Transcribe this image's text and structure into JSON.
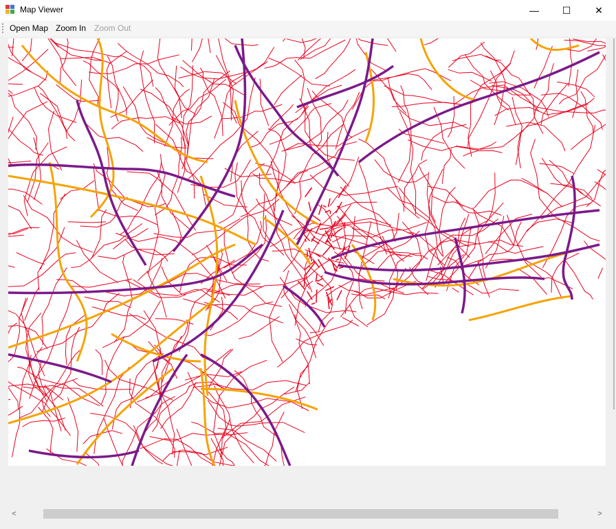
{
  "window": {
    "title": "Map Viewer",
    "icon": "app-icon"
  },
  "controls": {
    "minimize": "—",
    "maximize": "☐",
    "close": "✕"
  },
  "toolbar": {
    "open_label": "Open Map",
    "zoom_in_label": "Zoom In",
    "zoom_out_label": "Zoom Out"
  },
  "map": {
    "colors": {
      "minor_road": "#e8001c",
      "arterial": "#f5a300",
      "highway": "#7b1a8a",
      "background": "#ffffff"
    }
  },
  "scrollbar": {
    "left_arrow": "<",
    "right_arrow": ">"
  }
}
